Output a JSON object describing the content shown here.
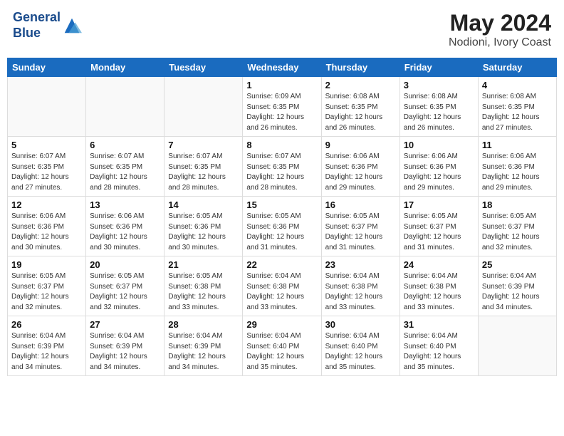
{
  "header": {
    "logo_line1": "General",
    "logo_line2": "Blue",
    "month": "May 2024",
    "location": "Nodioni, Ivory Coast"
  },
  "weekdays": [
    "Sunday",
    "Monday",
    "Tuesday",
    "Wednesday",
    "Thursday",
    "Friday",
    "Saturday"
  ],
  "weeks": [
    [
      {
        "day": "",
        "info": ""
      },
      {
        "day": "",
        "info": ""
      },
      {
        "day": "",
        "info": ""
      },
      {
        "day": "1",
        "info": "Sunrise: 6:09 AM\nSunset: 6:35 PM\nDaylight: 12 hours\nand 26 minutes."
      },
      {
        "day": "2",
        "info": "Sunrise: 6:08 AM\nSunset: 6:35 PM\nDaylight: 12 hours\nand 26 minutes."
      },
      {
        "day": "3",
        "info": "Sunrise: 6:08 AM\nSunset: 6:35 PM\nDaylight: 12 hours\nand 26 minutes."
      },
      {
        "day": "4",
        "info": "Sunrise: 6:08 AM\nSunset: 6:35 PM\nDaylight: 12 hours\nand 27 minutes."
      }
    ],
    [
      {
        "day": "5",
        "info": "Sunrise: 6:07 AM\nSunset: 6:35 PM\nDaylight: 12 hours\nand 27 minutes."
      },
      {
        "day": "6",
        "info": "Sunrise: 6:07 AM\nSunset: 6:35 PM\nDaylight: 12 hours\nand 28 minutes."
      },
      {
        "day": "7",
        "info": "Sunrise: 6:07 AM\nSunset: 6:35 PM\nDaylight: 12 hours\nand 28 minutes."
      },
      {
        "day": "8",
        "info": "Sunrise: 6:07 AM\nSunset: 6:35 PM\nDaylight: 12 hours\nand 28 minutes."
      },
      {
        "day": "9",
        "info": "Sunrise: 6:06 AM\nSunset: 6:36 PM\nDaylight: 12 hours\nand 29 minutes."
      },
      {
        "day": "10",
        "info": "Sunrise: 6:06 AM\nSunset: 6:36 PM\nDaylight: 12 hours\nand 29 minutes."
      },
      {
        "day": "11",
        "info": "Sunrise: 6:06 AM\nSunset: 6:36 PM\nDaylight: 12 hours\nand 29 minutes."
      }
    ],
    [
      {
        "day": "12",
        "info": "Sunrise: 6:06 AM\nSunset: 6:36 PM\nDaylight: 12 hours\nand 30 minutes."
      },
      {
        "day": "13",
        "info": "Sunrise: 6:06 AM\nSunset: 6:36 PM\nDaylight: 12 hours\nand 30 minutes."
      },
      {
        "day": "14",
        "info": "Sunrise: 6:05 AM\nSunset: 6:36 PM\nDaylight: 12 hours\nand 30 minutes."
      },
      {
        "day": "15",
        "info": "Sunrise: 6:05 AM\nSunset: 6:36 PM\nDaylight: 12 hours\nand 31 minutes."
      },
      {
        "day": "16",
        "info": "Sunrise: 6:05 AM\nSunset: 6:37 PM\nDaylight: 12 hours\nand 31 minutes."
      },
      {
        "day": "17",
        "info": "Sunrise: 6:05 AM\nSunset: 6:37 PM\nDaylight: 12 hours\nand 31 minutes."
      },
      {
        "day": "18",
        "info": "Sunrise: 6:05 AM\nSunset: 6:37 PM\nDaylight: 12 hours\nand 32 minutes."
      }
    ],
    [
      {
        "day": "19",
        "info": "Sunrise: 6:05 AM\nSunset: 6:37 PM\nDaylight: 12 hours\nand 32 minutes."
      },
      {
        "day": "20",
        "info": "Sunrise: 6:05 AM\nSunset: 6:37 PM\nDaylight: 12 hours\nand 32 minutes."
      },
      {
        "day": "21",
        "info": "Sunrise: 6:05 AM\nSunset: 6:38 PM\nDaylight: 12 hours\nand 33 minutes."
      },
      {
        "day": "22",
        "info": "Sunrise: 6:04 AM\nSunset: 6:38 PM\nDaylight: 12 hours\nand 33 minutes."
      },
      {
        "day": "23",
        "info": "Sunrise: 6:04 AM\nSunset: 6:38 PM\nDaylight: 12 hours\nand 33 minutes."
      },
      {
        "day": "24",
        "info": "Sunrise: 6:04 AM\nSunset: 6:38 PM\nDaylight: 12 hours\nand 33 minutes."
      },
      {
        "day": "25",
        "info": "Sunrise: 6:04 AM\nSunset: 6:39 PM\nDaylight: 12 hours\nand 34 minutes."
      }
    ],
    [
      {
        "day": "26",
        "info": "Sunrise: 6:04 AM\nSunset: 6:39 PM\nDaylight: 12 hours\nand 34 minutes."
      },
      {
        "day": "27",
        "info": "Sunrise: 6:04 AM\nSunset: 6:39 PM\nDaylight: 12 hours\nand 34 minutes."
      },
      {
        "day": "28",
        "info": "Sunrise: 6:04 AM\nSunset: 6:39 PM\nDaylight: 12 hours\nand 34 minutes."
      },
      {
        "day": "29",
        "info": "Sunrise: 6:04 AM\nSunset: 6:40 PM\nDaylight: 12 hours\nand 35 minutes."
      },
      {
        "day": "30",
        "info": "Sunrise: 6:04 AM\nSunset: 6:40 PM\nDaylight: 12 hours\nand 35 minutes."
      },
      {
        "day": "31",
        "info": "Sunrise: 6:04 AM\nSunset: 6:40 PM\nDaylight: 12 hours\nand 35 minutes."
      },
      {
        "day": "",
        "info": ""
      }
    ]
  ]
}
